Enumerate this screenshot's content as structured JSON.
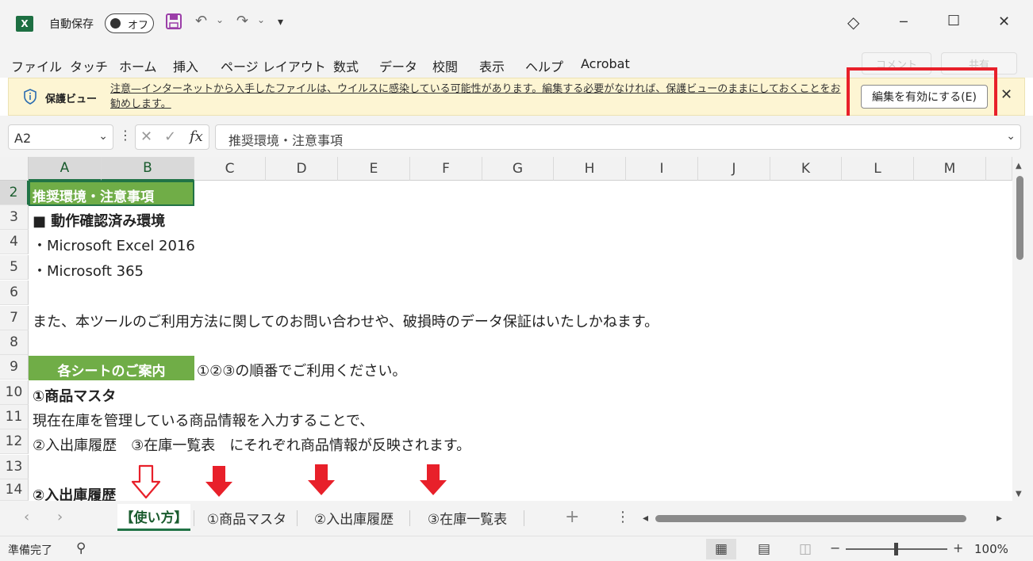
{
  "titlebar": {
    "app_letter": "X",
    "autosave_label": "自動保存",
    "autosave_state": "オフ",
    "save_icon": "💾",
    "undo_icon": "↶",
    "redo_icon": "↷",
    "dropdown_glyph": "⌄",
    "customize_icon": "▾",
    "diamond_icon": "◇",
    "minimize_glyph": "─",
    "maximize_glyph": "☐",
    "close_glyph": "✕"
  },
  "ribbon_tabs": [
    "ファイル",
    "タッチ",
    "ホーム",
    "挿入",
    "ページ レイアウト",
    "数式",
    "データ",
    "校閲",
    "表示",
    "ヘルプ",
    "Acrobat"
  ],
  "ribbon_right": {
    "comment": "コメント",
    "share": "共有"
  },
  "protected_view": {
    "title": "保護ビュー",
    "message": "注意—インターネットから入手したファイルは、ウイルスに感染している可能性があります。編集する必要がなければ、保護ビューのままにしておくことをお勧めします。",
    "enable_button": "編集を有効にする(E)",
    "close_glyph": "✕"
  },
  "formula_bar": {
    "name_box": "A2",
    "dropdown_glyph": "⌄",
    "more_glyph": "⋮",
    "cancel_glyph": "✕",
    "enter_glyph": "✓",
    "fx_label": "fx",
    "formula": "推奨環境・注意事項"
  },
  "columns": [
    "A",
    "B",
    "C",
    "D",
    "E",
    "F",
    "G",
    "H",
    "I",
    "J",
    "K",
    "L",
    "M"
  ],
  "rows": [
    "2",
    "3",
    "4",
    "5",
    "6",
    "7",
    "8",
    "9",
    "10",
    "11",
    "12",
    "13",
    "14"
  ],
  "cells": {
    "r2": "推奨環境・注意事項",
    "r3": "■ 動作確認済み環境",
    "r4": "・Microsoft Excel 2016",
    "r5": "・Microsoft 365",
    "r7": "また、本ツールのご利用方法に関してのお問い合わせや、破損時のデータ保証はいたしかねます。",
    "r9_label": "各シートのご案内",
    "r9_note": "①②③の順番でご利用ください。",
    "r10": "①商品マスタ",
    "r11": "現在在庫を管理している商品情報を入力することで、",
    "r12": "②入出庫履歴　③在庫一覧表　にそれぞれ商品情報が反映されます。",
    "r14": "②入出庫履歴"
  },
  "sheet_tabs": [
    "【使い方】",
    "①商品マスタ",
    "②入出庫履歴",
    "③在庫一覧表"
  ],
  "tab_nav": {
    "prev": "‹",
    "next": "›",
    "add": "+",
    "more": "⋮",
    "scroll_left": "◂",
    "scroll_right": "▸"
  },
  "status_bar": {
    "status": "準備完了",
    "accessibility_icon": "⚲",
    "view_normal": "▦",
    "view_layout": "▤",
    "view_pagebreak": "◫",
    "zoom_minus": "−",
    "zoom_plus": "+",
    "zoom": "100%"
  },
  "colors": {
    "excel_green": "#217346",
    "header_fill": "#70ad47",
    "arrow_red": "#e8202a",
    "protected_bar": "#fdf5d3"
  }
}
